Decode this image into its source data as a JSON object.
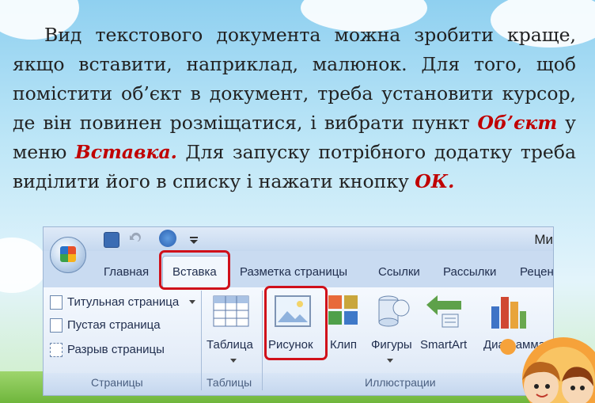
{
  "paragraph": {
    "part1": "Вид текстового документа можна зробити краще, якщо вставити, наприклад, малюнок. Для того, щоб помістити об’єкт в документ, треба установити курсор, де він повинен розміщатися, і вибрати пункт ",
    "em1": "Об’єкт",
    "part2": " у меню ",
    "em2": "Вставка.",
    "part3": " Для запуску потрібного додатку треба виділити його в списку і нажати кнопку ",
    "em3": "ОК."
  },
  "window": {
    "title_fragment": "Ми"
  },
  "tabs": [
    "Главная",
    "Вставка",
    "Разметка страницы",
    "Ссылки",
    "Рассылки",
    "Рецен"
  ],
  "pages_group": {
    "commands": [
      "Титульная страница",
      "Пустая страница",
      "Разрыв страницы"
    ],
    "label": "Страницы"
  },
  "tables_group": {
    "button": "Таблица",
    "label": "Таблицы"
  },
  "illustrations_group": {
    "buttons": [
      "Рисунок",
      "Клип",
      "Фигуры",
      "SmartArt",
      "Диаграмма"
    ],
    "label": "Иллюстрации"
  },
  "icons": [
    "save-icon",
    "undo-icon",
    "redo-icon",
    "office-button-icon",
    "title-page-icon",
    "blank-page-icon",
    "page-break-icon",
    "table-icon",
    "picture-icon",
    "clip-art-icon",
    "shapes-icon",
    "smartart-icon",
    "chart-icon"
  ],
  "colors": {
    "highlight": "#d0101a",
    "emphasis": "#c00000"
  }
}
